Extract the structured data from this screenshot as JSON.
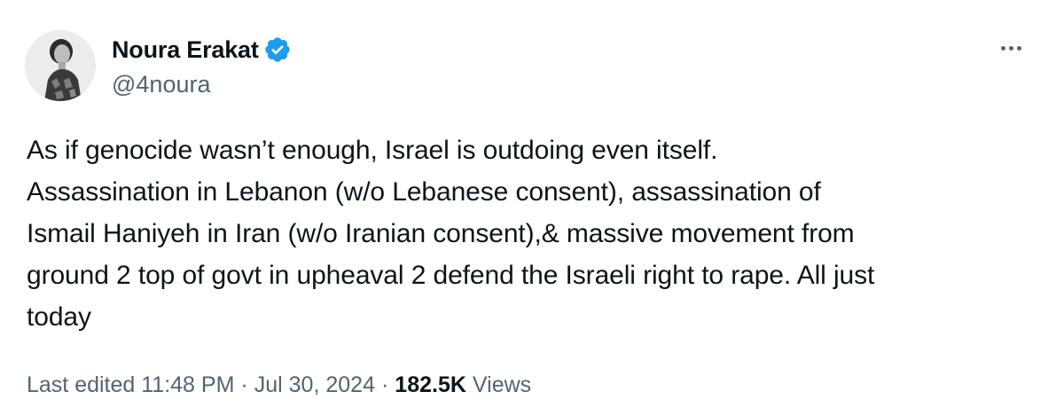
{
  "author": {
    "display_name": "Noura Erakat",
    "handle": "@4noura",
    "verified_icon": "verified-badge-icon",
    "avatar_icon": "avatar-photo"
  },
  "more_icon": "more-options-icon",
  "tweet": {
    "text": "As if genocide wasn’t enough, Israel is outdoing even itself.\nAssassination in Lebanon (w/o Lebanese consent), assassination of\nIsmail Haniyeh in Iran (w/o Iranian consent),& massive movement from\nground 2 top of govt in upheaval 2 defend the Israeli right to rape. All just\ntoday"
  },
  "meta": {
    "edited": "Last edited 11:48 PM",
    "separator": "·",
    "date": "Jul 30, 2024",
    "views_count": "182.5K",
    "views_label": "Views"
  },
  "colors": {
    "text_primary": "#0f1419",
    "text_secondary": "#536471",
    "verified_blue": "#1d9bf0"
  }
}
